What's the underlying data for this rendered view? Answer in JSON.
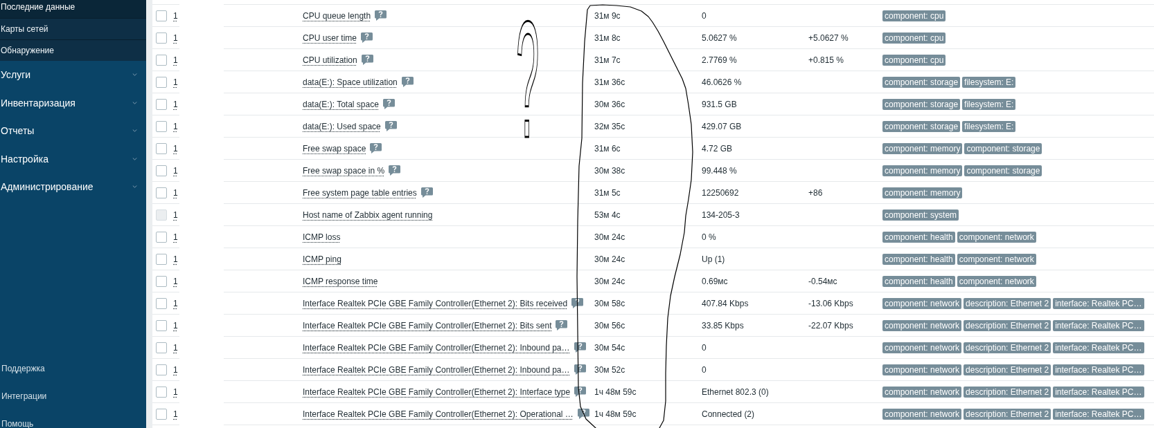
{
  "sidebar": {
    "submenu": [
      {
        "label": "Последние данные",
        "selected": true
      },
      {
        "label": "Карты сетей",
        "selected": false
      },
      {
        "label": "Обнаружение",
        "selected": false
      }
    ],
    "menu": [
      {
        "label": "Услуги",
        "expanded": false
      },
      {
        "label": "Инвентаризация",
        "expanded": false
      },
      {
        "label": "Отчеты",
        "expanded": false
      },
      {
        "label": "Настройка",
        "expanded": false
      },
      {
        "label": "Администрирование",
        "expanded": false
      }
    ],
    "footer": [
      "Поддержка",
      "Интеграции",
      "Помощь"
    ]
  },
  "table": {
    "rows": [
      {
        "checked": false,
        "disabled": false,
        "host": "1",
        "name": "CPU queue length",
        "help": true,
        "last_check": "31м 9с",
        "last_value": "0",
        "tags": [
          "component: cpu"
        ]
      },
      {
        "checked": false,
        "disabled": false,
        "host": "1",
        "name": "CPU user time",
        "help": true,
        "last_check": "31м 8с",
        "last_value": "5.0627 %",
        "change": "+5.0627 %",
        "tags": [
          "component: cpu"
        ]
      },
      {
        "checked": false,
        "disabled": false,
        "host": "1",
        "name": "CPU utilization",
        "help": true,
        "last_check": "31м 7с",
        "last_value": "2.7769 %",
        "change": "+0.815 %",
        "tags": [
          "component: cpu"
        ]
      },
      {
        "checked": false,
        "disabled": false,
        "host": "1",
        "name": "data(E:): Space utilization",
        "help": true,
        "last_check": "31м 36с",
        "last_value": "46.0626 %",
        "tags": [
          "component: storage",
          "filesystem: E:"
        ]
      },
      {
        "checked": false,
        "disabled": false,
        "host": "1",
        "name": "data(E:): Total space",
        "help": true,
        "last_check": "30м 36с",
        "last_value": "931.5 GB",
        "tags": [
          "component: storage",
          "filesystem: E:"
        ]
      },
      {
        "checked": false,
        "disabled": false,
        "host": "1",
        "name": "data(E:): Used space",
        "help": true,
        "last_check": "32м 35с",
        "last_value": "429.07 GB",
        "tags": [
          "component: storage",
          "filesystem: E:"
        ]
      },
      {
        "checked": false,
        "disabled": false,
        "host": "1",
        "name": "Free swap space",
        "help": true,
        "last_check": "31м 6с",
        "last_value": "4.72 GB",
        "tags": [
          "component: memory",
          "component: storage"
        ]
      },
      {
        "checked": false,
        "disabled": false,
        "host": "1",
        "name": "Free swap space in %",
        "help": true,
        "last_check": "30м 38с",
        "last_value": "99.448 %",
        "tags": [
          "component: memory",
          "component: storage"
        ]
      },
      {
        "checked": false,
        "disabled": false,
        "host": "1",
        "name": "Free system page table entries",
        "help": true,
        "last_check": "31м 5с",
        "last_value": "12250692",
        "change": "+86",
        "tags": [
          "component: memory"
        ]
      },
      {
        "checked": false,
        "disabled": true,
        "host": "1",
        "name": "Host name of Zabbix agent running",
        "help": false,
        "last_check": "53м 4с",
        "last_value": "134-205-3",
        "tags": [
          "component: system"
        ]
      },
      {
        "checked": false,
        "disabled": false,
        "host": "1",
        "name": "ICMP loss",
        "help": false,
        "last_check": "30м 24с",
        "last_value": "0 %",
        "tags": [
          "component: health",
          "component: network"
        ]
      },
      {
        "checked": false,
        "disabled": false,
        "host": "1",
        "name": "ICMP ping",
        "help": false,
        "last_check": "30м 24с",
        "last_value": "Up (1)",
        "tags": [
          "component: health",
          "component: network"
        ]
      },
      {
        "checked": false,
        "disabled": false,
        "host": "1",
        "name": "ICMP response time",
        "help": false,
        "last_check": "30м 24с",
        "last_value": "0.69мс",
        "change": "-0.54мс",
        "tags": [
          "component: health",
          "component: network"
        ]
      },
      {
        "checked": false,
        "disabled": false,
        "host": "1",
        "name": "Interface Realtek PCIe GBE Family Controller(Ethernet 2): Bits received",
        "help": true,
        "last_check": "30м 58с",
        "last_value": "407.84 Kbps",
        "change": "-13.06 Kbps",
        "tags": [
          "component: network",
          "description: Ethernet 2",
          "interface: Realtek PC…"
        ]
      },
      {
        "checked": false,
        "disabled": false,
        "host": "1",
        "name": "Interface Realtek PCIe GBE Family Controller(Ethernet 2): Bits sent",
        "help": true,
        "last_check": "30м 56с",
        "last_value": "33.85 Kbps",
        "change": "-22.07 Kbps",
        "tags": [
          "component: network",
          "description: Ethernet 2",
          "interface: Realtek PC…"
        ]
      },
      {
        "checked": false,
        "disabled": false,
        "host": "1",
        "name": "Interface Realtek PCIe GBE Family Controller(Ethernet 2): Inbound pa…",
        "help": true,
        "last_check": "30м 54с",
        "last_value": "0",
        "tags": [
          "component: network",
          "description: Ethernet 2",
          "interface: Realtek PC…"
        ]
      },
      {
        "checked": false,
        "disabled": false,
        "host": "1",
        "name": "Interface Realtek PCIe GBE Family Controller(Ethernet 2): Inbound pa…",
        "help": true,
        "last_check": "30м 52с",
        "last_value": "0",
        "tags": [
          "component: network",
          "description: Ethernet 2",
          "interface: Realtek PC…"
        ]
      },
      {
        "checked": false,
        "disabled": false,
        "host": "1",
        "name": "Interface Realtek PCIe GBE Family Controller(Ethernet 2): Interface type",
        "help": true,
        "last_check": "1ч 48м 59с",
        "last_value": "Ethernet 802.3 (0)",
        "tags": [
          "component: network",
          "description: Ethernet 2",
          "interface: Realtek PC…"
        ]
      },
      {
        "checked": false,
        "disabled": false,
        "host": "1",
        "name": "Interface Realtek PCIe GBE Family Controller(Ethernet 2): Operational …",
        "help": true,
        "last_check": "1ч 48м 59с",
        "last_value": "Connected (2)",
        "tags": [
          "component: network",
          "description: Ethernet 2",
          "interface: Realtek PC…"
        ]
      }
    ]
  },
  "annotation": {
    "text": "?"
  }
}
